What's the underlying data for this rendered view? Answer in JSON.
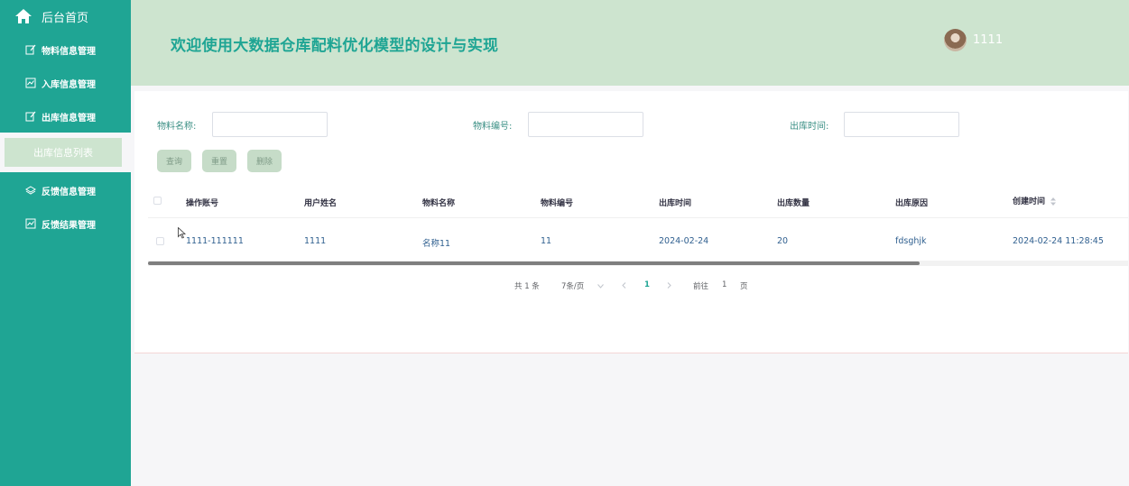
{
  "sidebar": {
    "home_label": "后台首页",
    "items": [
      {
        "label": "物料信息管理",
        "icon": "edit-icon"
      },
      {
        "label": "入库信息管理",
        "icon": "chart-icon"
      },
      {
        "label": "出库信息管理",
        "icon": "edit-icon"
      },
      {
        "label": "反馈信息管理",
        "icon": "layers-icon"
      },
      {
        "label": "反馈结果管理",
        "icon": "chart-icon"
      }
    ],
    "active_sub": "出库信息列表"
  },
  "header": {
    "title": "欢迎使用大数据仓库配料优化模型的设计与实现",
    "username": "1111"
  },
  "search": {
    "material_name_label": "物料名称:",
    "material_code_label": "物料编号:",
    "outbound_time_label": "出库时间:",
    "material_name_value": "",
    "material_code_value": "",
    "outbound_time_value": ""
  },
  "buttons": {
    "query": "查询",
    "reset": "重置",
    "delete": "删除"
  },
  "table": {
    "columns": [
      "操作账号",
      "用户姓名",
      "物料名称",
      "物料编号",
      "出库时间",
      "出库数量",
      "出库原因",
      "创建时间"
    ],
    "rows": [
      [
        "1111-111111",
        "1111",
        "名称11",
        "11",
        "2024-02-24",
        "20",
        "fdsghjk",
        "2024-02-24 11:28:45"
      ]
    ]
  },
  "pagination": {
    "total": "共 1 条",
    "page_size": "7条/页",
    "current_page": "1",
    "goto_label": "前往",
    "goto_value": "1",
    "page_unit": "页"
  },
  "colors": {
    "sidebar": "#1fa594",
    "header": "#cde4cf",
    "accent": "#1fa594"
  }
}
